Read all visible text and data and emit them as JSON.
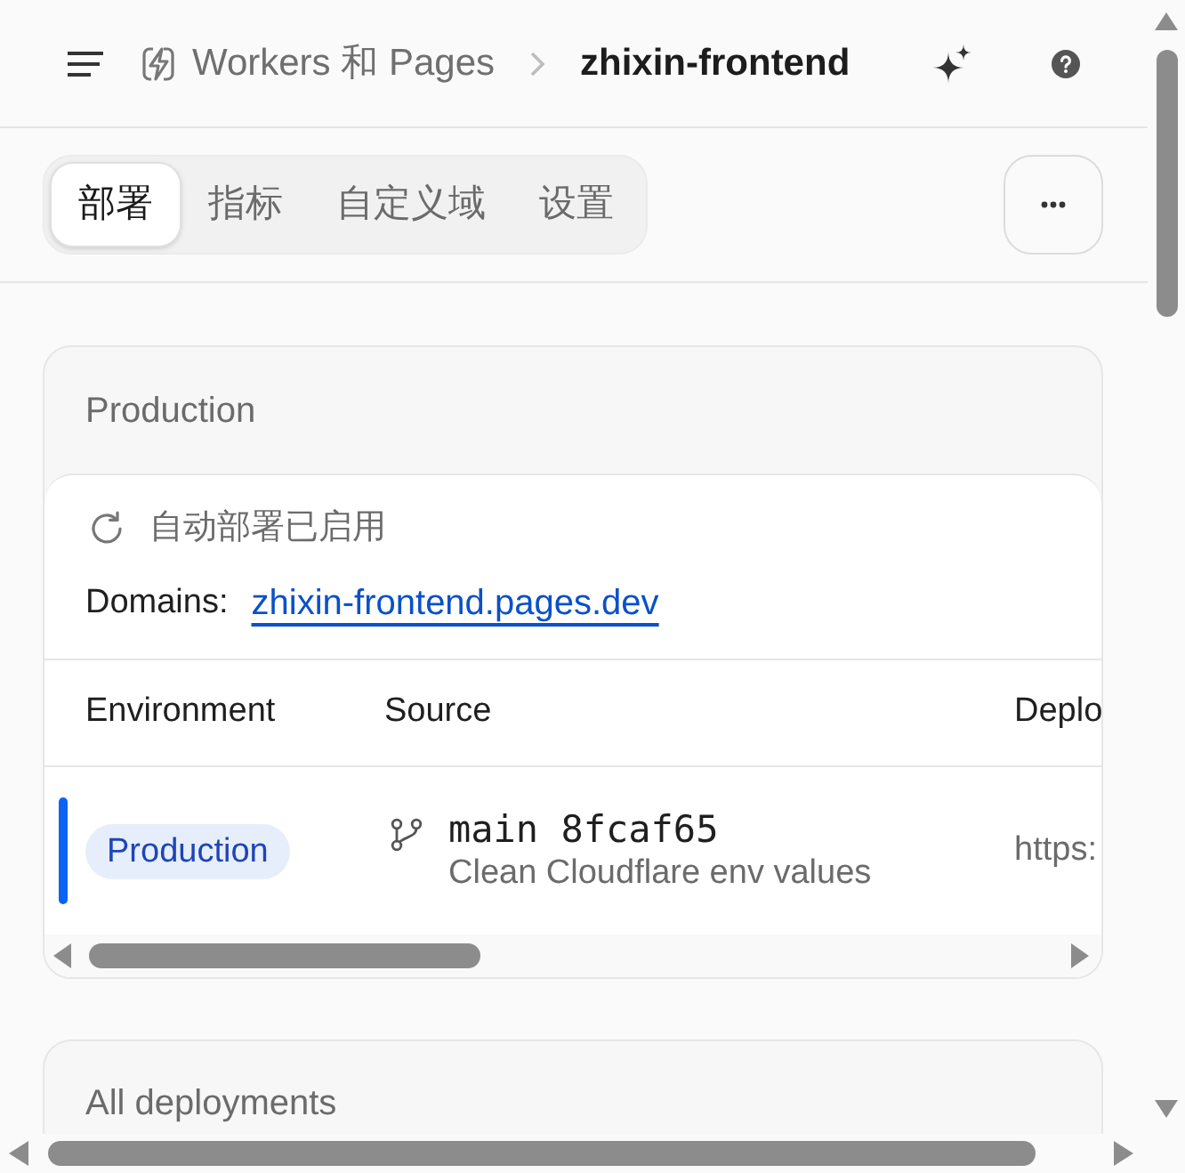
{
  "header": {
    "breadcrumb": [
      {
        "kind": "link",
        "label": "Workers 和 Pages"
      },
      {
        "kind": "current",
        "label": "zhixin-frontend"
      }
    ]
  },
  "tabs": [
    {
      "label": "部署",
      "selected": true
    },
    {
      "label": "指标",
      "selected": false
    },
    {
      "label": "自定义域",
      "selected": false
    },
    {
      "label": "设置",
      "selected": false
    }
  ],
  "production": {
    "title": "Production",
    "auto_deploy_status": "自动部署已启用",
    "domains_label": "Domains:",
    "domains": [
      "zhixin-frontend.pages.dev"
    ],
    "table": {
      "columns": [
        "Environment",
        "Source",
        "Deplo"
      ],
      "rows": [
        {
          "active": true,
          "environment": "Production",
          "source": "main 8fcaf65",
          "message": "Clean Cloudflare env values",
          "column_3": "https:"
        }
      ]
    }
  },
  "all_deployments": {
    "title": "All deployments"
  }
}
